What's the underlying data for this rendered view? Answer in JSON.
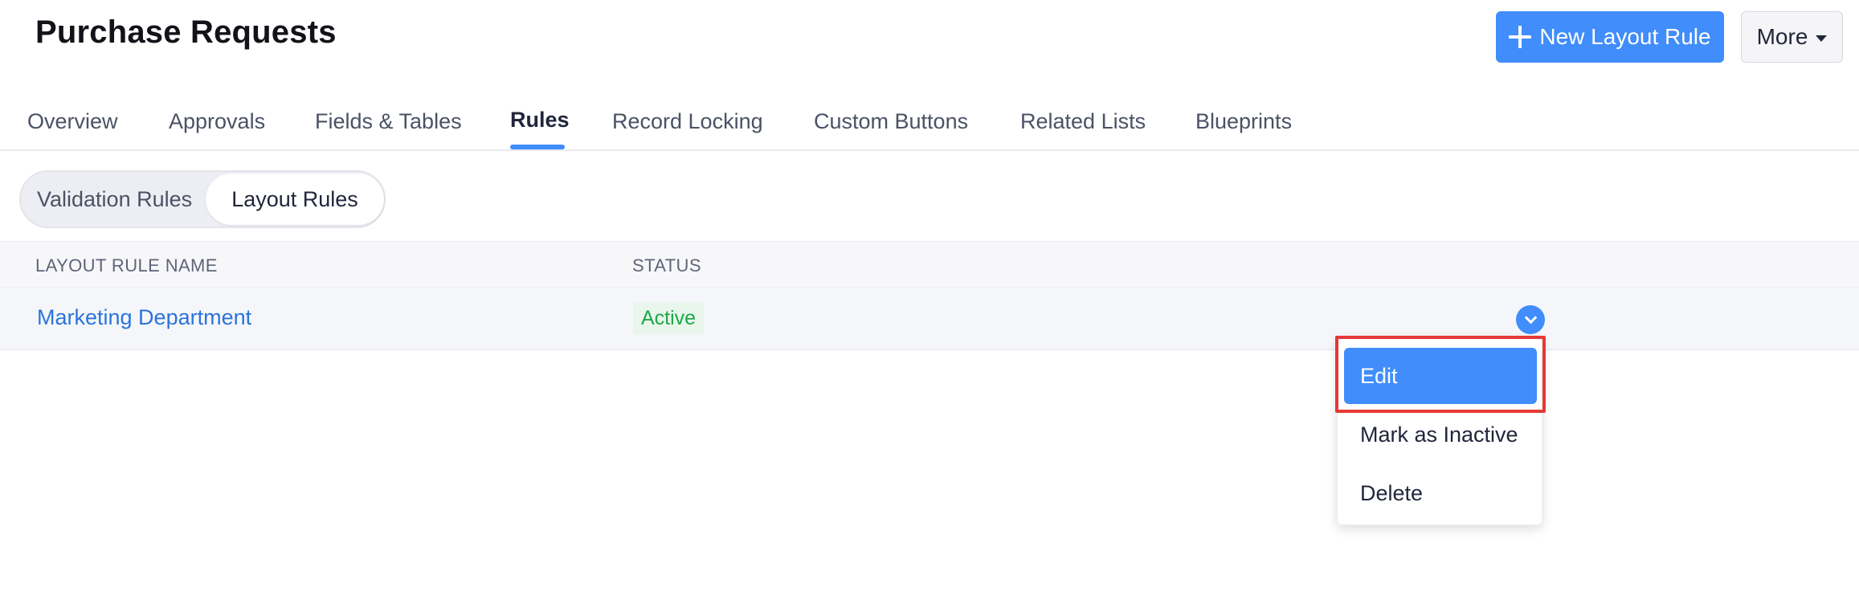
{
  "header": {
    "title": "Purchase Requests",
    "new_button_label": "New Layout Rule",
    "more_button_label": "More"
  },
  "tabs": [
    {
      "label": "Overview"
    },
    {
      "label": "Approvals"
    },
    {
      "label": "Fields & Tables"
    },
    {
      "label": "Rules",
      "active": true
    },
    {
      "label": "Record Locking"
    },
    {
      "label": "Custom Buttons"
    },
    {
      "label": "Related Lists"
    },
    {
      "label": "Blueprints"
    }
  ],
  "segmented": {
    "options": [
      "Validation Rules",
      "Layout Rules"
    ],
    "selected": "Layout Rules"
  },
  "table": {
    "columns": [
      "LAYOUT RULE NAME",
      "STATUS"
    ],
    "rows": [
      {
        "name": "Marketing Department",
        "status": "Active"
      }
    ]
  },
  "menu": {
    "items": [
      "Edit",
      "Mark as Inactive",
      "Delete"
    ],
    "highlighted": "Edit"
  },
  "colors": {
    "accent": "#408dfb",
    "link": "#2a74db",
    "status_active_text": "#1ca84a",
    "status_active_bg": "#e9f6ec",
    "highlight_border": "#e53935"
  }
}
